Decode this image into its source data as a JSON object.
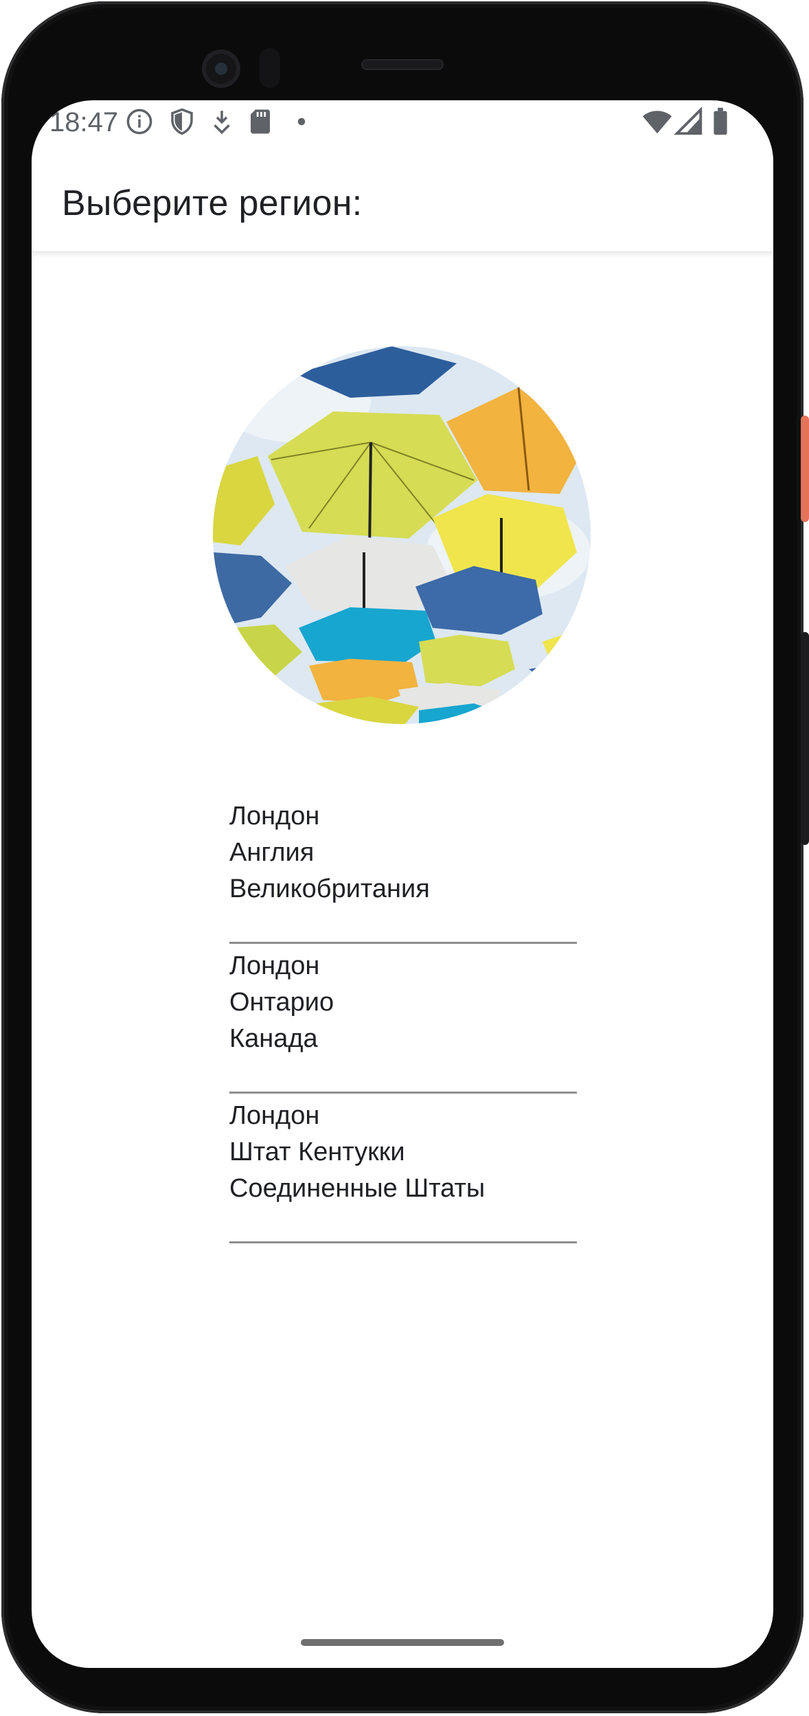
{
  "status_bar": {
    "time": "18:47",
    "left_icons": [
      "info-icon",
      "shield-icon",
      "download-icon",
      "sd-card-icon",
      "dot-icon"
    ],
    "right_icons": [
      "wifi-icon",
      "signal-icon",
      "battery-icon"
    ]
  },
  "app_bar": {
    "title": "Выберите регион:"
  },
  "image": {
    "description_icon": "umbrellas-photo",
    "colors": [
      "#2d5e9c",
      "#d8de4f",
      "#f2b33f",
      "#e8e8e8",
      "#17a6cf"
    ]
  },
  "regions": [
    {
      "city": "Лондон",
      "region": "Англия",
      "country": "Великобритания"
    },
    {
      "city": "Лондон",
      "region": "Онтарио",
      "country": "Канада"
    },
    {
      "city": "Лондон",
      "region": "Штат Кентукки",
      "country": "Соединенные Штаты"
    }
  ],
  "colors": {
    "phone": "#0b0b0c",
    "power_button": "#e4735a",
    "divider": "#8e8e8e",
    "text": "#202124"
  }
}
